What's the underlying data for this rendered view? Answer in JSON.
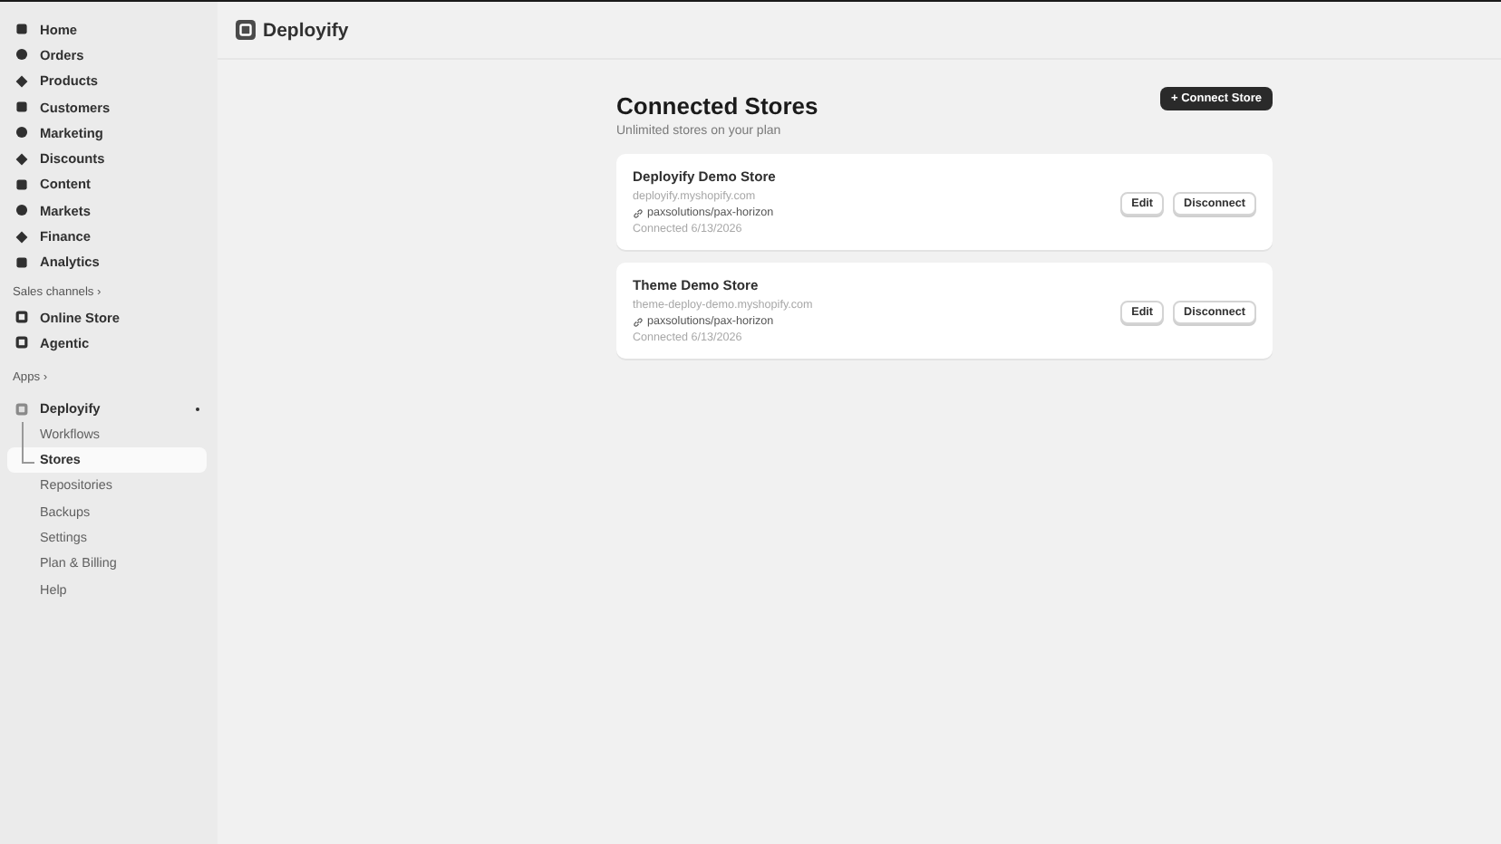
{
  "sidebar": {
    "items": [
      {
        "label": "Home"
      },
      {
        "label": "Orders"
      },
      {
        "label": "Products"
      },
      {
        "label": "Customers"
      },
      {
        "label": "Marketing"
      },
      {
        "label": "Discounts"
      },
      {
        "label": "Content"
      },
      {
        "label": "Markets"
      },
      {
        "label": "Finance"
      },
      {
        "label": "Analytics"
      }
    ],
    "sales_channels": {
      "heading": "Sales channels",
      "chevron": "›",
      "items": [
        {
          "label": "Online Store"
        },
        {
          "label": "Agentic"
        }
      ]
    },
    "apps": {
      "heading": "Apps",
      "chevron": "›",
      "app": {
        "label": "Deployify",
        "pinned": true
      },
      "children": [
        {
          "label": "Workflows",
          "selected": false
        },
        {
          "label": "Stores",
          "selected": true
        },
        {
          "label": "Repositories",
          "selected": false
        },
        {
          "label": "Backups",
          "selected": false
        },
        {
          "label": "Settings",
          "selected": false
        },
        {
          "label": "Plan & Billing",
          "selected": false
        },
        {
          "label": "Help",
          "selected": false
        }
      ]
    }
  },
  "header": {
    "title": "Deployify"
  },
  "page": {
    "title": "Connected Stores",
    "subtitle": "Unlimited stores on your plan",
    "action": "+ Connect Store"
  },
  "stores": [
    {
      "name": "Deployify Demo Store",
      "domain": "deployify.myshopify.com",
      "repo": "paxsolutions/pax-horizon",
      "connected": "Connected 6/13/2026",
      "buttons": [
        "Edit",
        "Disconnect"
      ]
    },
    {
      "name": "Theme Demo Store",
      "domain": "theme-deploy-demo.myshopify.com",
      "repo": "paxsolutions/pax-horizon",
      "connected": "Connected 6/13/2026",
      "buttons": [
        "Edit",
        "Disconnect"
      ]
    }
  ]
}
